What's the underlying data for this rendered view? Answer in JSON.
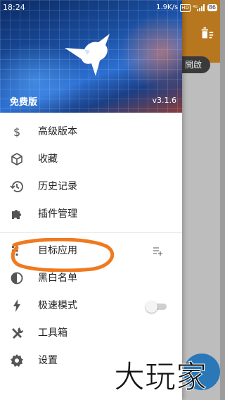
{
  "status_bar": {
    "time": "18:24",
    "speed": "1.9K/s",
    "hd": "HD",
    "network": "4G",
    "battery": "86"
  },
  "drawer": {
    "edition": "免费版",
    "version": "v3.1.6",
    "items": [
      {
        "label": "高级版本",
        "icon": "dollar-icon"
      },
      {
        "label": "收藏",
        "icon": "cube-icon"
      },
      {
        "label": "历史记录",
        "icon": "history-icon"
      },
      {
        "label": "插件管理",
        "icon": "puzzle-icon"
      },
      {
        "label": "目标应用",
        "icon": "apps-grid-icon"
      },
      {
        "label": "黑白名单",
        "icon": "contrast-icon"
      },
      {
        "label": "极速模式",
        "icon": "bolt-icon",
        "toggle": false
      },
      {
        "label": "工具箱",
        "icon": "tools-icon"
      },
      {
        "label": "设置",
        "icon": "gear-icon"
      }
    ]
  },
  "background": {
    "pill_label": "開啟"
  },
  "watermark": {
    "text": "大玩家"
  },
  "colors": {
    "accent": "#b6771f",
    "annotation": "#f07a1f",
    "icon": "#555555",
    "fab": "#2a78b8"
  }
}
